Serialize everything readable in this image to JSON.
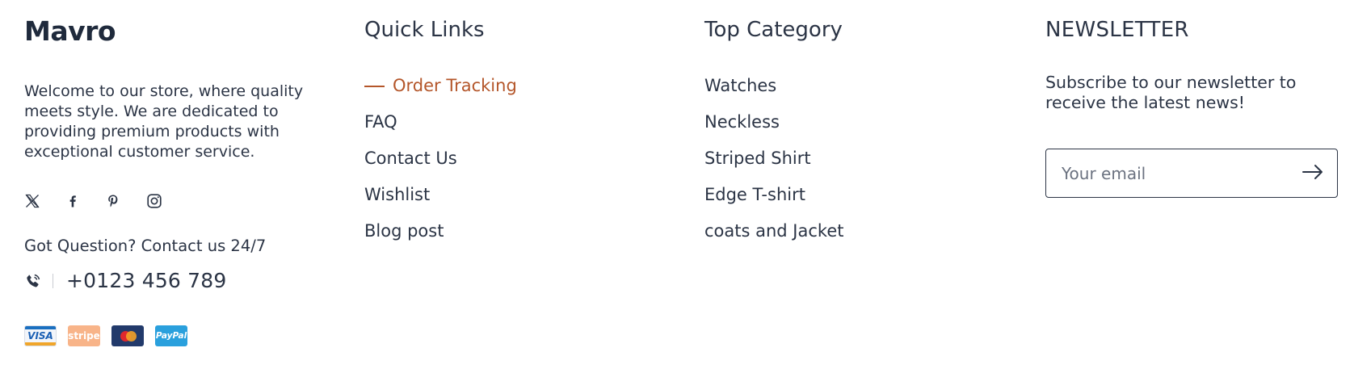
{
  "brand": {
    "logo_text": "Mavro",
    "about": "Welcome to our store, where quality meets style. We are dedicated to providing premium products with exceptional customer service.",
    "socials": [
      {
        "name": "x-twitter-icon"
      },
      {
        "name": "facebook-icon"
      },
      {
        "name": "pinterest-icon"
      },
      {
        "name": "instagram-icon"
      }
    ],
    "question": "Got Question? Contact us 24/7",
    "phone_icon": "phone-icon",
    "phone": "+0123 456 789",
    "payments": [
      "VISA",
      "stripe",
      "mastercard",
      "PayPal"
    ]
  },
  "quick_links": {
    "title": "Quick Links",
    "items": [
      {
        "label": "Order Tracking",
        "active": true
      },
      {
        "label": "FAQ"
      },
      {
        "label": "Contact Us"
      },
      {
        "label": "Wishlist"
      },
      {
        "label": "Blog post"
      }
    ]
  },
  "top_category": {
    "title": "Top Category",
    "items": [
      {
        "label": "Watches"
      },
      {
        "label": "Neckless"
      },
      {
        "label": "Striped Shirt"
      },
      {
        "label": "Edge T-shirt"
      },
      {
        "label": "coats and Jacket"
      }
    ]
  },
  "newsletter": {
    "title": "NEWSLETTER",
    "text": "Subscribe to our newsletter to receive the latest news!",
    "input_placeholder": "Your email",
    "submit_icon": "arrow-right-icon"
  },
  "colors": {
    "text": "#2b3445",
    "accent": "#b4562a",
    "background": "#ffffff"
  }
}
